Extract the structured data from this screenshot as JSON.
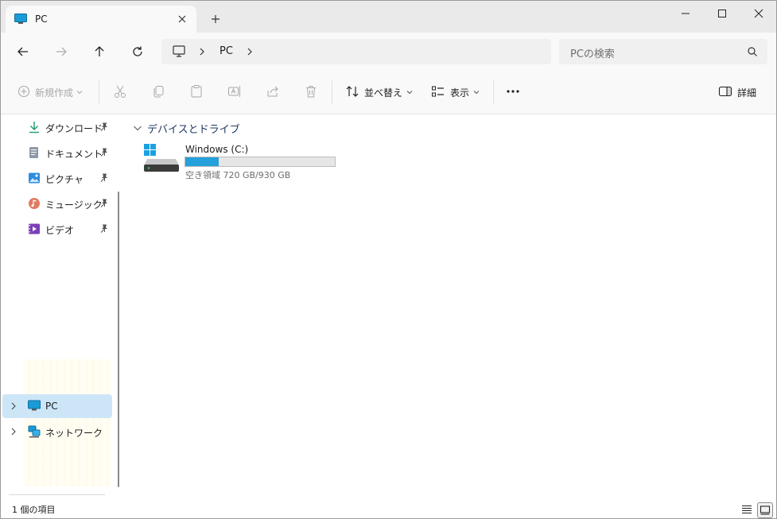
{
  "tab": {
    "title": "PC"
  },
  "address": {
    "crumbs": [
      "PC"
    ]
  },
  "search": {
    "placeholder": "PCの検索"
  },
  "commands": {
    "new": "新規作成",
    "sort": "並べ替え",
    "view": "表示",
    "details": "詳細"
  },
  "nav": {
    "quick_access": [
      {
        "label": "ダウンロード",
        "icon": "download-icon"
      },
      {
        "label": "ドキュメント",
        "icon": "document-icon"
      },
      {
        "label": "ピクチャ",
        "icon": "pictures-icon"
      },
      {
        "label": "ミュージック",
        "icon": "music-icon"
      },
      {
        "label": "ビデオ",
        "icon": "video-icon"
      }
    ],
    "tree": [
      {
        "label": "PC",
        "icon": "pc-icon",
        "selected": true
      },
      {
        "label": "ネットワーク",
        "icon": "network-icon",
        "selected": false
      }
    ]
  },
  "main": {
    "group_title": "デバイスとドライブ",
    "drives": [
      {
        "name": "Windows (C:)",
        "free_text": "空き領域 720 GB/930 GB",
        "used_fraction": 0.226
      }
    ]
  },
  "status": {
    "item_count": "1 個の項目"
  },
  "colors": {
    "accent": "#26a0da",
    "selected_bg": "#cde6f7"
  }
}
